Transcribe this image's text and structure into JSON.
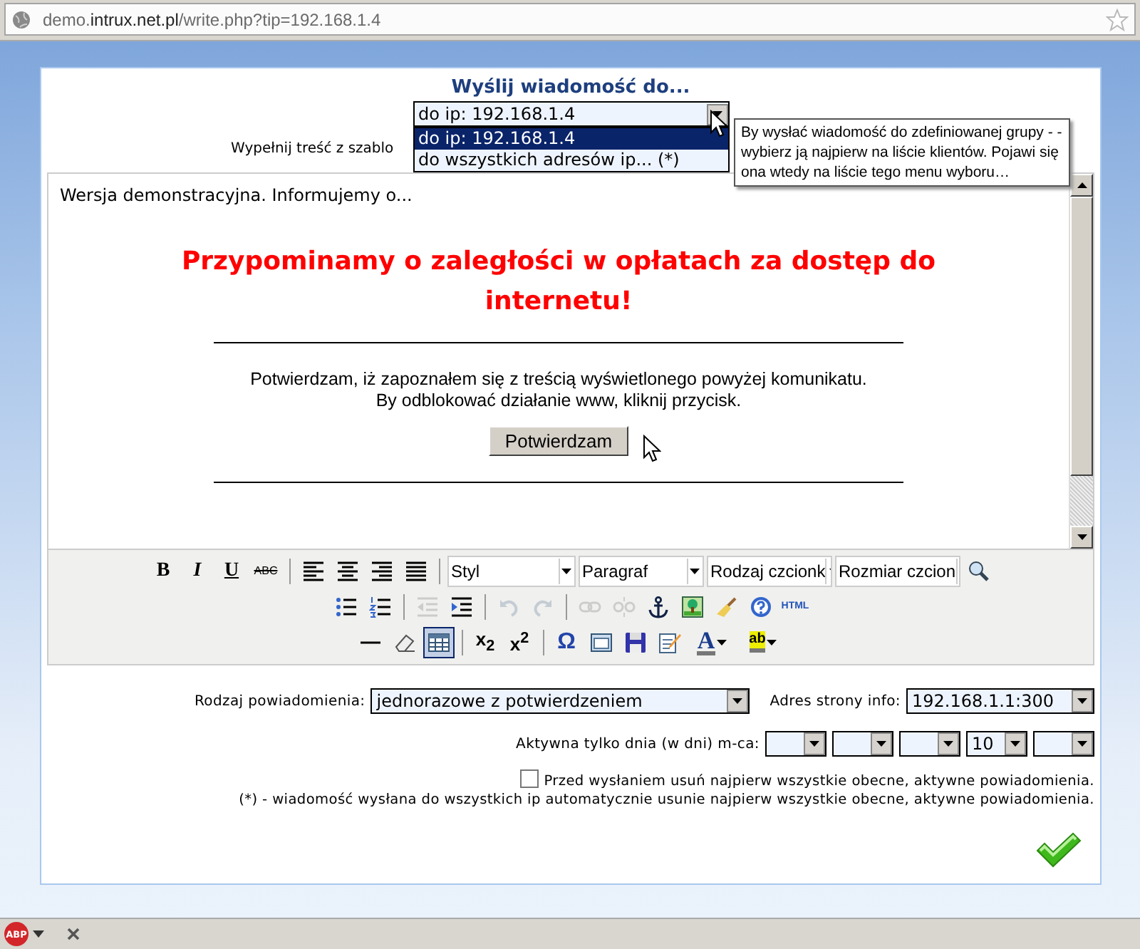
{
  "browser": {
    "url": {
      "subdomain": "demo.",
      "domain": "intrux.net.pl",
      "path": "/write.php?tip=192.168.1.4"
    }
  },
  "heading": "Wyślij wiadomość do...",
  "recipient_select": {
    "value": "do ip: 192.168.1.4",
    "expanded": true,
    "options": [
      {
        "label": "do ip: 192.168.1.4",
        "selected": true
      },
      {
        "label": "do wszystkich adresów ip... (*)",
        "selected": false
      }
    ]
  },
  "template_label": "Wypełnij treść z szablo",
  "tooltip": "By wysłać wiadomość do zdefiniowanej grupy - - wybierz ją najpierw na liście klientów. Pojawi się ona wtedy na liście tego menu wyboru…",
  "editor": {
    "intro": "Wersja demonstracyjna. Informujemy o...",
    "alert": "Przypominamy o zaległości w opłatach za dostęp do internetu!",
    "confirm_lines": [
      "Potwierdzam, iż zapoznałem się z treścią wyświetlonego powyżej komunikatu.",
      "By odblokować działanie www, kliknij przycisk."
    ],
    "confirm_button": "Potwierdzam"
  },
  "toolbar": {
    "rows": [
      [
        {
          "kind": "bold",
          "label": "B",
          "disabled": false,
          "active": false
        },
        {
          "kind": "italic",
          "label": "I",
          "disabled": false,
          "active": false
        },
        {
          "kind": "underline",
          "label": "U",
          "disabled": false,
          "active": false
        },
        {
          "kind": "strike",
          "label": "ABC",
          "disabled": false,
          "active": false
        },
        {
          "kind": "separator"
        },
        {
          "kind": "alignleft",
          "disabled": false,
          "active": false
        },
        {
          "kind": "aligncenter",
          "disabled": false,
          "active": false
        },
        {
          "kind": "alignright",
          "disabled": false,
          "active": false
        },
        {
          "kind": "justify",
          "disabled": false,
          "active": false
        },
        {
          "kind": "separator"
        },
        {
          "kind": "select",
          "label": "Styl"
        },
        {
          "kind": "select",
          "label": "Paragraf"
        },
        {
          "kind": "select",
          "label": "Rodzaj czcionk"
        },
        {
          "kind": "select",
          "label": "Rozmiar czcion"
        },
        {
          "kind": "preview",
          "disabled": false,
          "active": false
        }
      ],
      [
        {
          "kind": "bullets",
          "disabled": false,
          "active": false
        },
        {
          "kind": "numbers",
          "disabled": false,
          "active": false
        },
        {
          "kind": "separator"
        },
        {
          "kind": "outdent",
          "disabled": true,
          "active": false
        },
        {
          "kind": "indent",
          "disabled": false,
          "active": false
        },
        {
          "kind": "separator"
        },
        {
          "kind": "undo",
          "disabled": true,
          "active": false
        },
        {
          "kind": "redo",
          "disabled": true,
          "active": false
        },
        {
          "kind": "separator"
        },
        {
          "kind": "link",
          "disabled": true,
          "active": false
        },
        {
          "kind": "unlink",
          "disabled": true,
          "active": false
        },
        {
          "kind": "anchor",
          "disabled": false,
          "active": false
        },
        {
          "kind": "image",
          "disabled": false,
          "active": false
        },
        {
          "kind": "cleanup",
          "disabled": false,
          "active": false
        },
        {
          "kind": "help",
          "disabled": false,
          "active": false
        },
        {
          "kind": "html",
          "label": "HTML",
          "disabled": false,
          "active": false
        }
      ],
      [
        {
          "kind": "hr",
          "disabled": false,
          "active": false
        },
        {
          "kind": "eraser",
          "disabled": false,
          "active": false
        },
        {
          "kind": "table",
          "disabled": false,
          "active": true
        },
        {
          "kind": "separator"
        },
        {
          "kind": "sub",
          "label": "x$_{2}$",
          "disabled": false,
          "active": false
        },
        {
          "kind": "sup",
          "label": "x$^{2}$",
          "disabled": false,
          "active": false
        },
        {
          "kind": "separator"
        },
        {
          "kind": "charmap",
          "label": "Ω",
          "disabled": false,
          "active": false
        },
        {
          "kind": "frame",
          "disabled": false,
          "active": false
        },
        {
          "kind": "save",
          "disabled": false,
          "active": false
        },
        {
          "kind": "edit",
          "disabled": false,
          "active": false
        },
        {
          "kind": "forecolor",
          "label": "A",
          "disabled": false,
          "active": false
        },
        {
          "kind": "backcolor",
          "label": "ab",
          "disabled": false,
          "active": false
        }
      ]
    ]
  },
  "notification_type": {
    "label": "Rodzaj powiadomienia:",
    "value": "jednorazowe z potwierdzeniem"
  },
  "info_address": {
    "label": "Adres strony info:",
    "value": "192.168.1.1:300"
  },
  "active_days": {
    "label": "Aktywna tylko dnia (w dni) m-ca:",
    "selects": [
      {
        "kind": "blank"
      },
      {
        "kind": "blank"
      },
      {
        "kind": "blank"
      },
      {
        "kind": "value",
        "value": "10"
      },
      {
        "kind": "blank"
      }
    ]
  },
  "remove_checkbox": {
    "label": "Przed wysłaniem usuń najpierw wszystkie obecne, aktywne powiadomienia.",
    "checked": false
  },
  "footnote": "(*) - wiadomość wysłana do wszystkich ip automatycznie usunie najpierw wszystkie obecne, aktywne powiadomienia.",
  "status_bar": {
    "adblock_label": "ABP"
  }
}
